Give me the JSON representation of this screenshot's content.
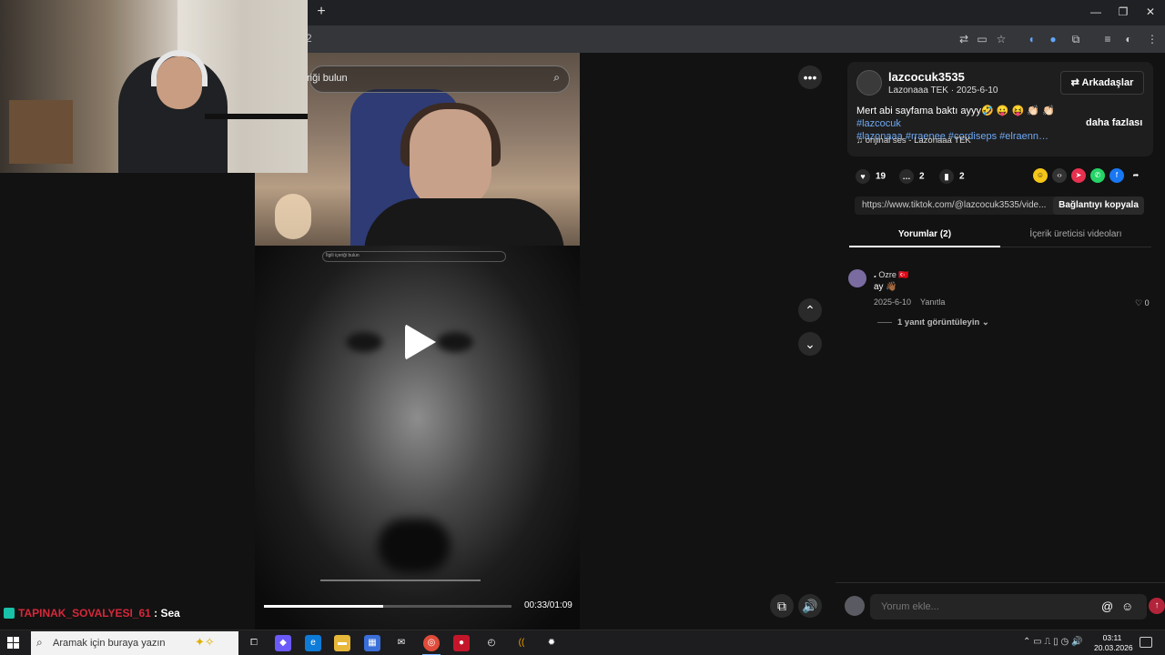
{
  "browser": {
    "new_tab_symbol": "+",
    "url_fragment": "2",
    "window_controls": {
      "minimize": "—",
      "restore": "❐",
      "close": "✕"
    }
  },
  "video": {
    "search_placeholder": "riği bulun",
    "inner_search_text": "İlgili içeriği bulun",
    "time": "00:33/01:09",
    "progress_fraction": 0.48
  },
  "chat": {
    "user": "TAPINAK_SOVALYESI_61",
    "separator": " : ",
    "message": "Sea"
  },
  "post": {
    "username": "lazcocuk3535",
    "display_name": "Lazonaaa TEK",
    "date": "2025-6-10",
    "subline_sep": " · ",
    "friends_button": "Arkadaşlar",
    "caption_text": "Mert abi sayfama baktı ayyy🤣 😛 😝 👏🏻 👏🏻 ",
    "hashtags_line1": "#lazcocuk",
    "hashtags_line2": "#lazonaaa #rraenee #cordiseps #elraenn…",
    "more_label": "daha fazlası",
    "music": "orijinal ses - Lazonaaa TEK",
    "likes": "19",
    "comments": "2",
    "saves": "2",
    "link": "https://www.tiktok.com/@lazcocuk3535/vide...",
    "copy_button": "Bağlantıyı kopyala"
  },
  "tabs": {
    "comments": "Yorumlar (2)",
    "creator_videos": "İçerik üreticisi videoları"
  },
  "comment": {
    "name": "𝅘 Ozre 🇹🇷",
    "text": "ay 👋🏾",
    "date": "2025-6-10",
    "reply": "Yanıtla",
    "likes": "0",
    "view_replies": "1 yanıt görüntüleyin"
  },
  "composer": {
    "placeholder": "Yorum ekle..."
  },
  "taskbar": {
    "search_placeholder": "Aramak için buraya yazın",
    "time": "03:11",
    "date": "20.03.2026"
  },
  "colors": {
    "accent_link": "#6fa9f4",
    "chat_user": "#d6283a",
    "send": "#b2243a"
  }
}
